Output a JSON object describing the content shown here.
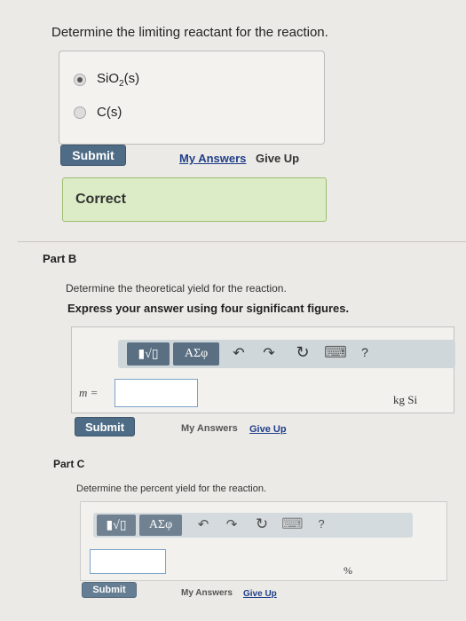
{
  "part_a": {
    "question": "Determine the limiting reactant for the reaction.",
    "choices": [
      {
        "label_main": "SiO",
        "label_sub": "2",
        "label_tail": "(s)",
        "selected": true
      },
      {
        "label_main": "C(s)",
        "selected": false
      }
    ],
    "submit_label": "Submit",
    "my_answers_label": "My Answers",
    "give_up_label": "Give Up",
    "feedback": "Correct"
  },
  "part_b": {
    "title": "Part B",
    "prompt": "Determine the theoretical yield for the reaction.",
    "instruction": "Express your answer using four significant figures.",
    "toolbar": {
      "template_glyph": "▮√▯",
      "symbols_label": "ΑΣφ",
      "undo_icon": "↶",
      "redo_icon": "↷",
      "reset_icon": "↻",
      "keyboard_icon": "⌨",
      "help_label": "?"
    },
    "variable_label": "m =",
    "input_value": "",
    "unit_label": "kg Si",
    "submit_label": "Submit",
    "my_answers_label": "My Answers",
    "give_up_label": "Give Up"
  },
  "part_c": {
    "title": "Part C",
    "prompt": "Determine the percent yield for the reaction.",
    "toolbar": {
      "template_glyph": "▮√▯",
      "symbols_label": "ΑΣφ",
      "undo_icon": "↶",
      "redo_icon": "↷",
      "reset_icon": "↻",
      "keyboard_icon": "⌨",
      "help_label": "?"
    },
    "input_value": "",
    "unit_label": "%",
    "submit_label": "Submit",
    "my_answers_label": "My Answers",
    "give_up_label": "Give Up"
  },
  "colors": {
    "submit_button": "#4f6c86",
    "correct_bg": "#dcecc6",
    "toolbar_bg": "#cfd7db",
    "link_blue": "#1f3f8a"
  }
}
